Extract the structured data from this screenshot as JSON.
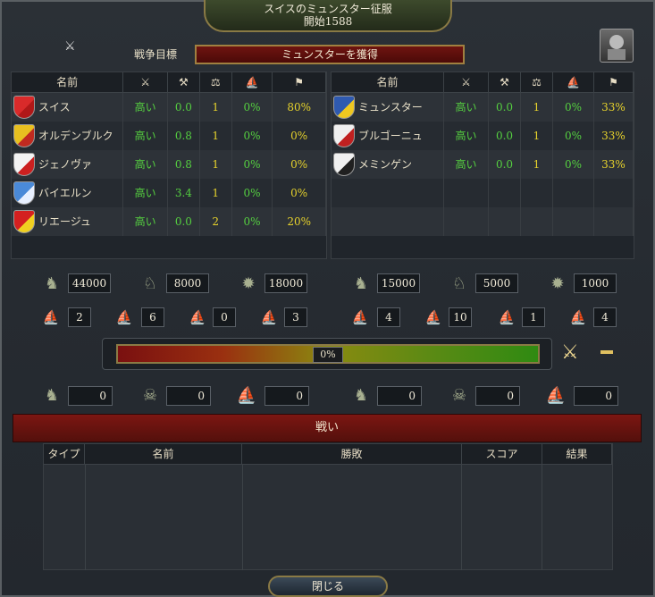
{
  "title": {
    "line1": "スイスのミュンスター征服",
    "line2": "開始1588"
  },
  "war_goal": {
    "label": "戦争目標",
    "value": "ミュンスターを獲得"
  },
  "columns": {
    "name": "名前"
  },
  "attackers": [
    {
      "name": "スイス",
      "attitude": "高い",
      "v1": "0.0",
      "v2": "1",
      "v3": "0%",
      "v4": "80%",
      "colors": [
        "#d92a2a",
        "#b01818"
      ]
    },
    {
      "name": "オルデンブルク",
      "attitude": "高い",
      "v1": "0.8",
      "v2": "1",
      "v3": "0%",
      "v4": "0%",
      "colors": [
        "#e8c020",
        "#c02a20"
      ]
    },
    {
      "name": "ジェノヴァ",
      "attitude": "高い",
      "v1": "0.8",
      "v2": "1",
      "v3": "0%",
      "v4": "0%",
      "colors": [
        "#f4f4f4",
        "#cc2020"
      ]
    },
    {
      "name": "バイエルン",
      "attitude": "高い",
      "v1": "3.4",
      "v2": "1",
      "v3": "0%",
      "v4": "0%",
      "colors": [
        "#4a8ad8",
        "#e8f0ff"
      ]
    },
    {
      "name": "リエージュ",
      "attitude": "高い",
      "v1": "0.0",
      "v2": "2",
      "v3": "0%",
      "v4": "20%",
      "colors": [
        "#d42020",
        "#f0d020"
      ]
    }
  ],
  "defenders": [
    {
      "name": "ミュンスター",
      "attitude": "高い",
      "v1": "0.0",
      "v2": "1",
      "v3": "0%",
      "v4": "33%",
      "colors": [
        "#2f5ab0",
        "#f0c820"
      ]
    },
    {
      "name": "ブルゴーニュ",
      "attitude": "高い",
      "v1": "0.0",
      "v2": "1",
      "v3": "0%",
      "v4": "33%",
      "colors": [
        "#f0f0f0",
        "#c02020"
      ]
    },
    {
      "name": "メミンゲン",
      "attitude": "高い",
      "v1": "0.0",
      "v2": "1",
      "v3": "0%",
      "v4": "33%",
      "colors": [
        "#f0f0f0",
        "#202020"
      ]
    }
  ],
  "attacker_forces": {
    "infantry": "44000",
    "cavalry": "8000",
    "artillery": "18000",
    "heavy_ships": "2",
    "light_ships": "6",
    "galleys": "0",
    "transports": "3"
  },
  "defender_forces": {
    "infantry": "15000",
    "cavalry": "5000",
    "artillery": "1000",
    "heavy_ships": "4",
    "light_ships": "10",
    "galleys": "1",
    "transports": "4"
  },
  "war_score": "0%",
  "attacker_losses": {
    "land": "0",
    "attrition": "0",
    "naval": "0"
  },
  "defender_losses": {
    "land": "0",
    "attrition": "0",
    "naval": "0"
  },
  "battles": {
    "title": "戦い",
    "headers": [
      "タイプ",
      "名前",
      "勝敗",
      "スコア",
      "結果"
    ]
  },
  "close_label": "閉じる",
  "icons": {
    "col_attitude": "crossed-swords-icon",
    "col_warscore": "axes-icon",
    "col_participation": "scales-icon",
    "col_losses": "ships-icon",
    "col_share": "flag-icon"
  }
}
